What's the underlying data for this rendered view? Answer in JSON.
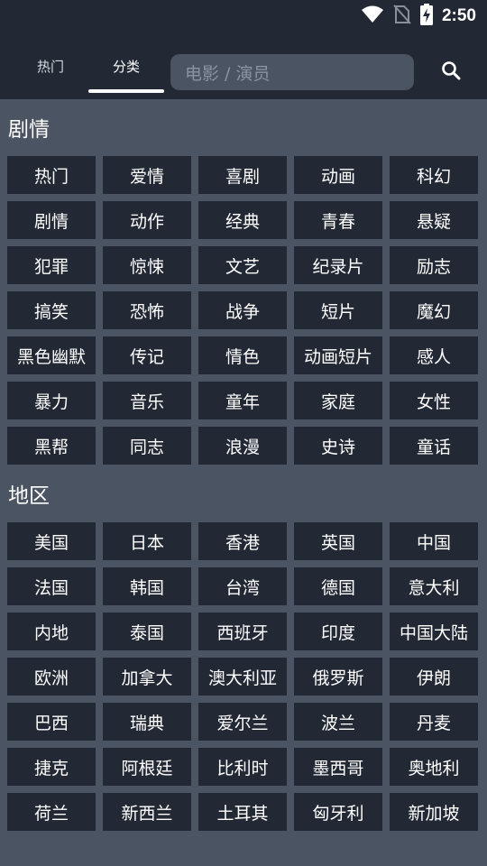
{
  "status_bar": {
    "time": "2:50"
  },
  "header": {
    "tabs": [
      {
        "label": "热门"
      },
      {
        "label": "分类"
      }
    ],
    "search_placeholder": "电影 / 演员"
  },
  "sections": [
    {
      "title": "剧情",
      "items": [
        "热门",
        "爱情",
        "喜剧",
        "动画",
        "科幻",
        "剧情",
        "动作",
        "经典",
        "青春",
        "悬疑",
        "犯罪",
        "惊悚",
        "文艺",
        "纪录片",
        "励志",
        "搞笑",
        "恐怖",
        "战争",
        "短片",
        "魔幻",
        "黑色幽默",
        "传记",
        "情色",
        "动画短片",
        "感人",
        "暴力",
        "音乐",
        "童年",
        "家庭",
        "女性",
        "黑帮",
        "同志",
        "浪漫",
        "史诗",
        "童话"
      ]
    },
    {
      "title": "地区",
      "items": [
        "美国",
        "日本",
        "香港",
        "英国",
        "中国",
        "法国",
        "韩国",
        "台湾",
        "德国",
        "意大利",
        "内地",
        "泰国",
        "西班牙",
        "印度",
        "中国大陆",
        "欧洲",
        "加拿大",
        "澳大利亚",
        "俄罗斯",
        "伊朗",
        "巴西",
        "瑞典",
        "爱尔兰",
        "波兰",
        "丹麦",
        "捷克",
        "阿根廷",
        "比利时",
        "墨西哥",
        "奥地利",
        "荷兰",
        "新西兰",
        "土耳其",
        "匈牙利",
        "新加坡"
      ]
    }
  ]
}
